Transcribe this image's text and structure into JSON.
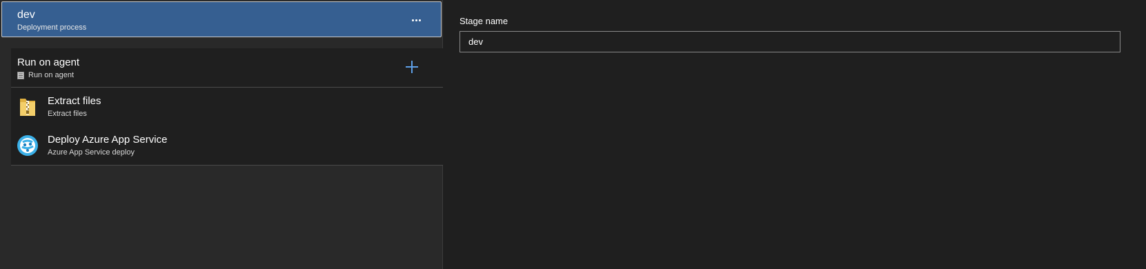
{
  "stage": {
    "title": "dev",
    "subtitle": "Deployment process",
    "more_icon": "more-horizontal-icon"
  },
  "phase": {
    "title": "Run on agent",
    "subtitle": "Run on agent",
    "icon": "agent-server-icon",
    "add_icon": "plus-icon"
  },
  "tasks": [
    {
      "title": "Extract files",
      "subtitle": "Extract files",
      "icon": "zip-folder-icon"
    },
    {
      "title": "Deploy Azure App Service",
      "subtitle": "Azure App Service deploy",
      "icon": "azure-app-service-icon"
    }
  ],
  "form": {
    "stage_name_label": "Stage name",
    "stage_name_value": "dev"
  },
  "colors": {
    "selected_stage_bg": "#365f91",
    "accent_plus": "#5ea0e8",
    "pane_bg": "#1f1f1f"
  }
}
